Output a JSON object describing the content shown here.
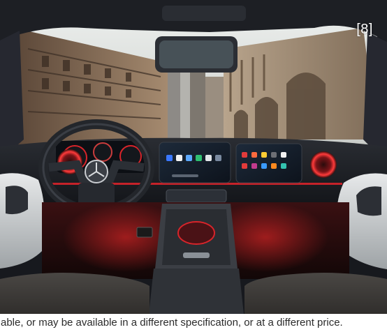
{
  "gallery": {
    "counter_label": "[8]",
    "disclaimer": "able, or may be available in a different specification, or at a different price."
  },
  "colors": {
    "ambient_red": "#d8242a",
    "interior_dark": "#16181d",
    "city_stone": "#9a8068",
    "sky": "#dfe3e2"
  }
}
